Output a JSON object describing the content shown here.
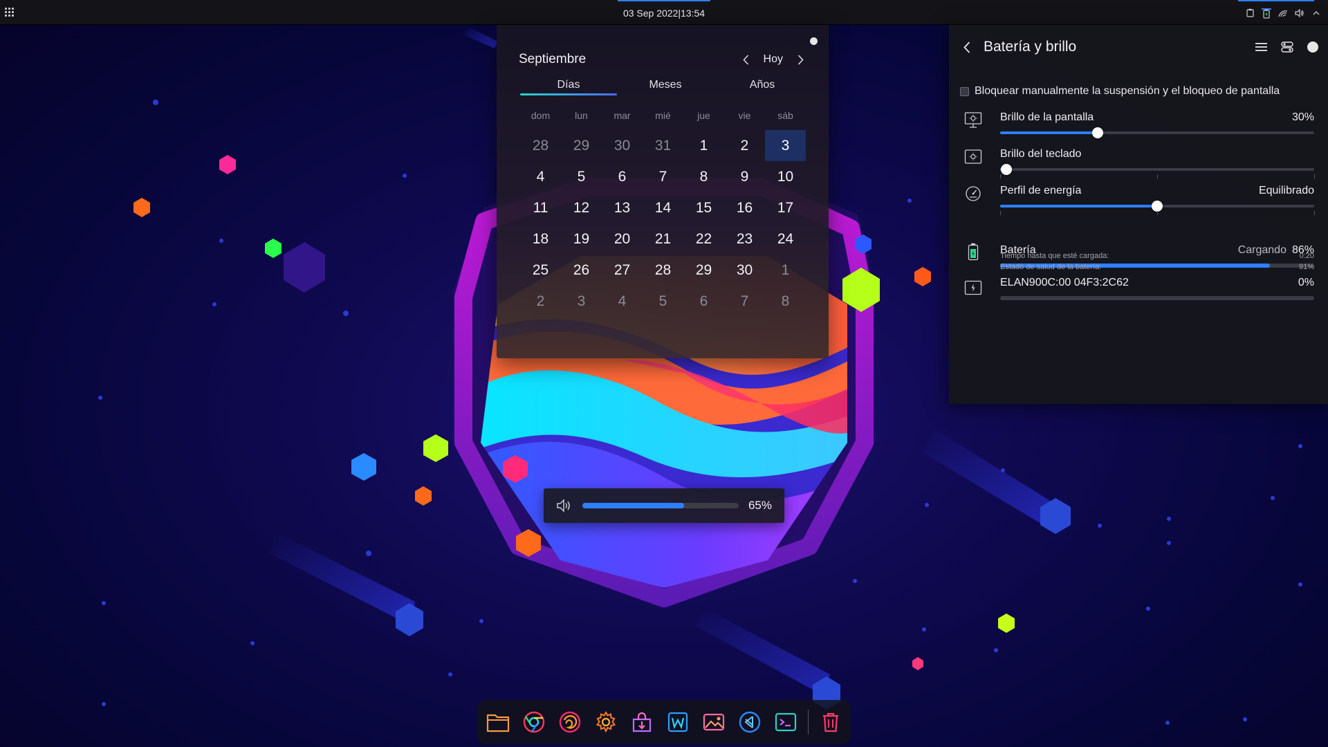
{
  "top_panel": {
    "datetime": "03 Sep 2022|13:54",
    "tray_icons": [
      "clipboard-icon",
      "battery-charging-icon",
      "network-icon",
      "volume-icon",
      "chevron-up-icon"
    ]
  },
  "calendar": {
    "month": "Septiembre",
    "today_label": "Hoy",
    "tabs": [
      {
        "label": "Días",
        "active": true
      },
      {
        "label": "Meses",
        "active": false
      },
      {
        "label": "Años",
        "active": false
      }
    ],
    "weekdays": [
      "dom",
      "lun",
      "mar",
      "mié",
      "jue",
      "vie",
      "sáb"
    ],
    "days": [
      {
        "d": "28",
        "muted": true
      },
      {
        "d": "29",
        "muted": true
      },
      {
        "d": "30",
        "muted": true
      },
      {
        "d": "31",
        "muted": true
      },
      {
        "d": "1"
      },
      {
        "d": "2"
      },
      {
        "d": "3",
        "today": true
      },
      {
        "d": "4"
      },
      {
        "d": "5"
      },
      {
        "d": "6"
      },
      {
        "d": "7"
      },
      {
        "d": "8"
      },
      {
        "d": "9"
      },
      {
        "d": "10"
      },
      {
        "d": "11"
      },
      {
        "d": "12"
      },
      {
        "d": "13"
      },
      {
        "d": "14"
      },
      {
        "d": "15"
      },
      {
        "d": "16"
      },
      {
        "d": "17"
      },
      {
        "d": "18"
      },
      {
        "d": "19"
      },
      {
        "d": "20"
      },
      {
        "d": "21"
      },
      {
        "d": "22"
      },
      {
        "d": "23"
      },
      {
        "d": "24"
      },
      {
        "d": "25"
      },
      {
        "d": "26"
      },
      {
        "d": "27"
      },
      {
        "d": "28"
      },
      {
        "d": "29"
      },
      {
        "d": "30"
      },
      {
        "d": "1",
        "muted": true
      },
      {
        "d": "2",
        "muted": true
      },
      {
        "d": "3",
        "muted": true
      },
      {
        "d": "4",
        "muted": true
      },
      {
        "d": "5",
        "muted": true
      },
      {
        "d": "6",
        "muted": true
      },
      {
        "d": "7",
        "muted": true
      },
      {
        "d": "8",
        "muted": true
      }
    ]
  },
  "volume_osd": {
    "value_label": "65%",
    "level": 0.65
  },
  "battery_panel": {
    "title": "Batería y brillo",
    "lock_label": "Bloquear manualmente la suspensión y el bloqueo de pantalla",
    "screen_brightness": {
      "label": "Brillo de la pantalla",
      "value_label": "30%",
      "level": 0.31
    },
    "keyboard_brightness": {
      "label": "Brillo del teclado",
      "level": 0.02
    },
    "energy_profile": {
      "label": "Perfil de energía",
      "value_label": "Equilibrado",
      "level": 0.5
    },
    "battery": {
      "label": "Batería",
      "status": "Cargando",
      "value_label": "86%",
      "level": 0.86
    },
    "details": [
      {
        "label": "Tiempo hasta que esté cargada:",
        "value": "0:20"
      },
      {
        "label": "Estado de salud de la batería:",
        "value": "91%"
      }
    ],
    "device": {
      "label": "ELAN900C:00 04F3:2C62",
      "value_label": "0%",
      "level": 0.0
    }
  },
  "dock": {
    "items": [
      {
        "name": "files-icon"
      },
      {
        "name": "chrome-icon"
      },
      {
        "name": "firefox-icon"
      },
      {
        "name": "settings-icon"
      },
      {
        "name": "software-center-icon"
      },
      {
        "name": "writer-icon"
      },
      {
        "name": "image-viewer-icon"
      },
      {
        "name": "vscode-icon"
      },
      {
        "name": "terminal-icon"
      },
      {
        "name": "trash-icon"
      }
    ]
  },
  "colors": {
    "accent": "#2f80ff",
    "today_bg": "#1d2f63"
  }
}
